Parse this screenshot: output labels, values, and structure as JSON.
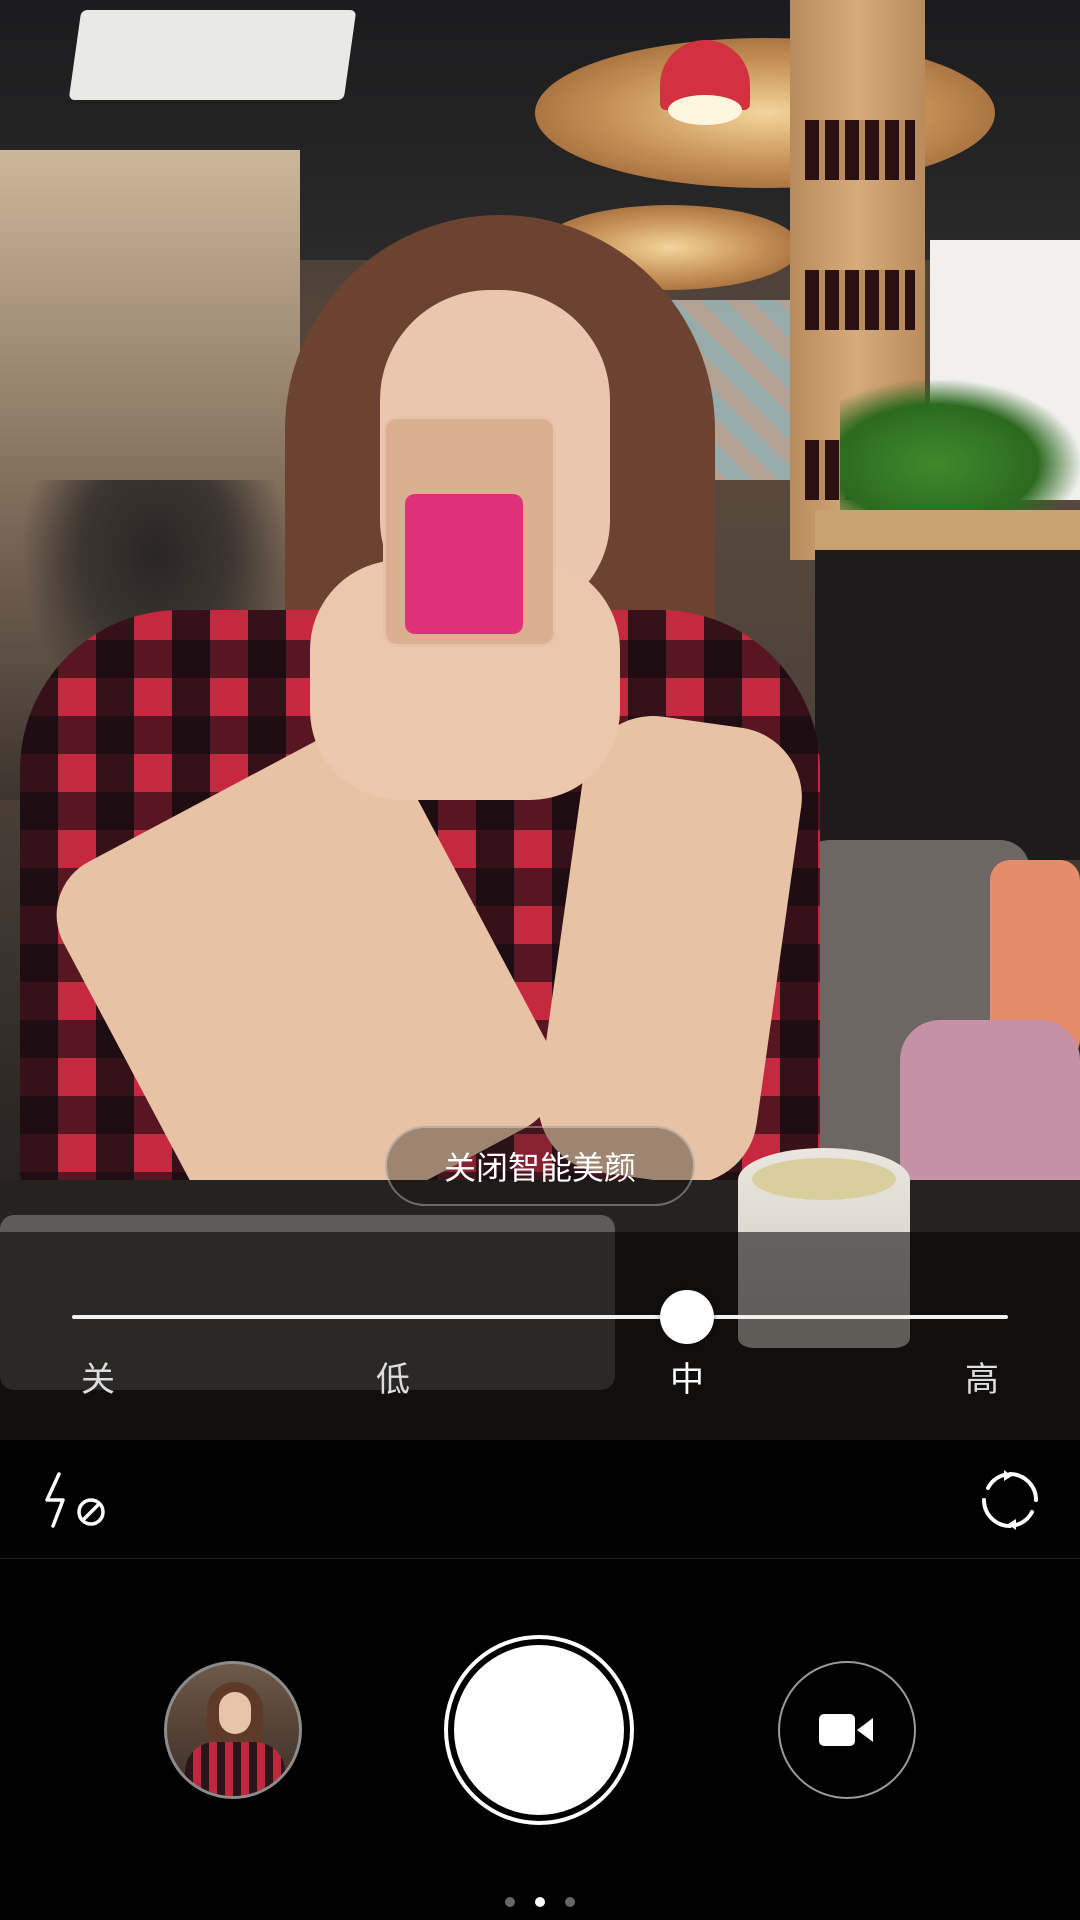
{
  "viewfinder": {
    "scene": "camera-preview"
  },
  "beauty": {
    "toggle_label": "关闭智能美颜",
    "levels": [
      "关",
      "低",
      "中",
      "高"
    ],
    "selected_level": "中",
    "slider_value": 2
  },
  "toolbar": {
    "flash_icon": "flash-off-icon",
    "switch_camera_icon": "switch-camera-icon"
  },
  "bottom": {
    "gallery_icon": "gallery-thumbnail",
    "shutter_icon": "shutter-button",
    "video_icon": "video-camera-icon",
    "pages": 3,
    "active_page": 1
  },
  "colors": {
    "background": "#000000",
    "shutter": "#ffffff",
    "slider_track": "#f2f2f2"
  }
}
